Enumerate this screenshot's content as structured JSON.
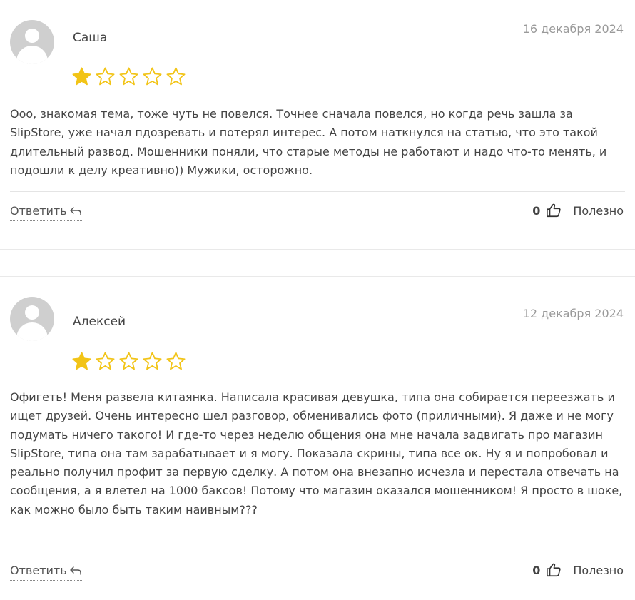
{
  "reviews": [
    {
      "author": "Саша",
      "date": "16 декабря 2024",
      "rating": 1,
      "max_rating": 5,
      "text": "Ооо, знакомая тема, тоже чуть не повелся. Точнее сначала повелся, но когда речь зашла за SlipStore, уже начал пдозревать и потерял интерес. А потом наткнулся на статью, что это такой длительный развод. Мошенники поняли, что старые методы не работают и надо что-то менять, и подошли к делу креативно)) Мужики, осторожно.",
      "reply_label": "Ответить",
      "helpful_count": "0",
      "helpful_label": "Полезно"
    },
    {
      "author": "Алексей",
      "date": "12 декабря 2024",
      "rating": 1,
      "max_rating": 5,
      "text": "Офигеть! Меня развела китаянка. Написала красивая девушка, типа она собирается переезжать и ищет друзей. Очень интересно шел разговор, обменивались фото (приличными). Я даже и не могу подумать ничего такого! И где-то через неделю общения она мне начала задвигать про магазин SlipStore, типа она там зарабатывает и я могу. Показала скрины, типа все ок. Ну я и попробовал и реально получил профит за первую сделку. А потом она внезапно исчезла и перестала отвечать на сообщения, а я влетел на 1000 баксов! Потому что магазин оказался мошенником! Я просто в шоке, как можно было быть таким наивным???",
      "reply_label": "Ответить",
      "helpful_count": "0",
      "helpful_label": "Полезно"
    }
  ],
  "colors": {
    "star_fill": "#f2c417",
    "star_outline": "#f2c417",
    "text": "#444444",
    "date": "#9a9a9a",
    "avatar_bg": "#cfcfcf"
  },
  "icons": {
    "reply": "reply-arrow-icon",
    "helpful": "thumbs-up-icon",
    "star": "star-icon",
    "avatar": "user-avatar-icon"
  }
}
